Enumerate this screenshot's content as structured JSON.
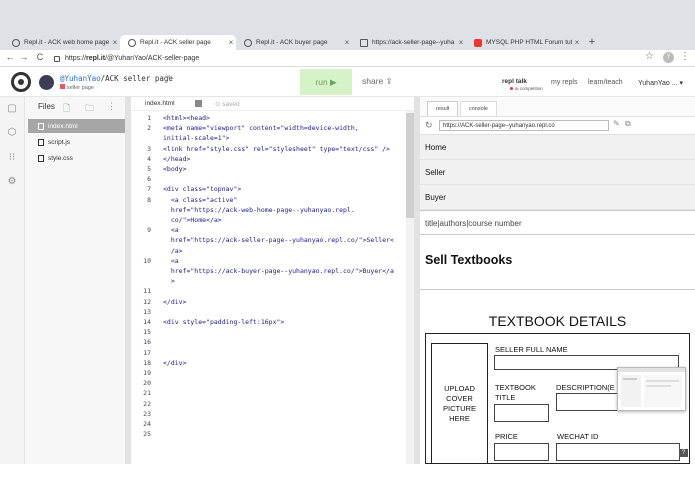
{
  "browser": {
    "tabs": [
      {
        "title": "Repl.it - ACK web home page"
      },
      {
        "title": "Repl.it - ACK seller page"
      },
      {
        "title": "Repl.it - ACK buyer page"
      },
      {
        "title": "https://ack-seller-page--yuha"
      },
      {
        "title": "MYSQL PHP HTML Forum tuto"
      }
    ],
    "new_tab": "+",
    "url_prefix": "https://",
    "url_host": "repl.it",
    "url_path": "/@YuhanYao/ACK-seller-page",
    "profile_initial": "Y"
  },
  "repl": {
    "owner": "@YuhanYao",
    "name": "/ACK seller page",
    "subtitle": "seller page",
    "run_label": "run ▶",
    "share_label": "share ⇪",
    "nav": {
      "repl_talk": "repl talk",
      "ai_competition": "ai competition",
      "my_repls": "my repls",
      "learn_teach": "learn/teach",
      "user": "YuhanYao ... ▾"
    }
  },
  "files": {
    "title": "Files",
    "items": [
      {
        "name": "index.html"
      },
      {
        "name": "script.js"
      },
      {
        "name": "style.css"
      }
    ]
  },
  "editor": {
    "file_tab": "index.html",
    "status": "saved",
    "lines": [
      {
        "n": "1",
        "code": "<html><head>"
      },
      {
        "n": "2",
        "code": "<meta name=\"viewport\" content=\"width=device-width,"
      },
      {
        "n": "",
        "code": "initial-scale=1\">"
      },
      {
        "n": "3",
        "code": "<link href=\"style.css\" rel=\"stylesheet\" type=\"text/css\" />"
      },
      {
        "n": "4",
        "code": "</head>"
      },
      {
        "n": "5",
        "code": "<body>"
      },
      {
        "n": "6",
        "code": ""
      },
      {
        "n": "7",
        "code": "<div class=\"topnav\">"
      },
      {
        "n": "8",
        "code": "  <a class=\"active\""
      },
      {
        "n": "",
        "code": "  href=\"https://ack-web-home-page--yuhanyao.repl."
      },
      {
        "n": "",
        "code": "  co/\">Home</a>"
      },
      {
        "n": "9",
        "code": "  <a"
      },
      {
        "n": "",
        "code": "  href=\"https://ack-seller-page--yuhanyao.repl.co/\">Seller<"
      },
      {
        "n": "",
        "code": "  /a>"
      },
      {
        "n": "10",
        "code": "  <a"
      },
      {
        "n": "",
        "code": "  href=\"https://ack-buyer-page--yuhanyao.repl.co/\">Buyer</a"
      },
      {
        "n": "",
        "code": "  >"
      },
      {
        "n": "11",
        "code": ""
      },
      {
        "n": "12",
        "code": "</div>"
      },
      {
        "n": "13",
        "code": ""
      },
      {
        "n": "14",
        "code": "<div style=\"padding-left:16px\">"
      },
      {
        "n": "15",
        "code": ""
      },
      {
        "n": "16",
        "code": ""
      },
      {
        "n": "17",
        "code": ""
      },
      {
        "n": "18",
        "code": "</div>"
      },
      {
        "n": "19",
        "code": ""
      },
      {
        "n": "20",
        "code": ""
      },
      {
        "n": "21",
        "code": ""
      },
      {
        "n": "22",
        "code": ""
      },
      {
        "n": "23",
        "code": ""
      },
      {
        "n": "24",
        "code": ""
      },
      {
        "n": "25",
        "code": ""
      }
    ]
  },
  "result": {
    "tabs": [
      {
        "label": "result"
      },
      {
        "label": "console"
      }
    ],
    "url": "https://ACK-seller-page--yuhanyao.repl.co",
    "nav_links": [
      {
        "label": "Home"
      },
      {
        "label": "Seller"
      },
      {
        "label": "Buyer"
      },
      {
        "label": "title|authors|course number"
      }
    ],
    "heading": "Sell Textbooks",
    "form_title": "TEXTBOOK DETAILS",
    "upload_label": "UPLOAD COVER PICTURE HERE",
    "fields": {
      "seller_full_name": "SELLER FULL NAME",
      "textbook_title": "TEXTBOOK TITLE",
      "description": "DESCRIPTION(E",
      "price": "PRICE",
      "wechat_id": "WECHAT ID"
    },
    "help": "?"
  },
  "colors": {
    "run_bg": "#d6f2c7",
    "run_text": "#6aa45a",
    "active_file_bg": "#a6a6a6",
    "link_blue": "#2c6bd6"
  }
}
